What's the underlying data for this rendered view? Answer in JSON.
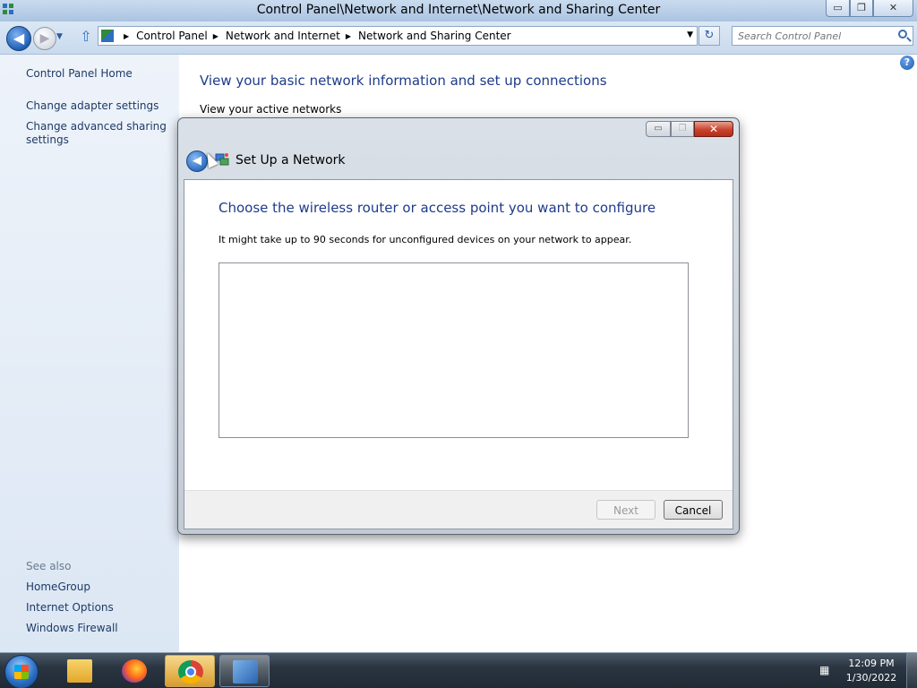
{
  "window": {
    "title": "Control Panel\\Network and Internet\\Network and Sharing Center",
    "buttons": {
      "minimize": "▭",
      "maximize": "❐",
      "close": "✕"
    }
  },
  "navigation": {
    "breadcrumbs": [
      "Control Panel",
      "Network and Internet",
      "Network and Sharing Center"
    ],
    "search_placeholder": "Search Control Panel"
  },
  "sidebar": {
    "links": [
      "Control Panel Home",
      "Change adapter settings",
      "Change advanced sharing settings"
    ],
    "see_also_label": "See also",
    "see_also": [
      "HomeGroup",
      "Internet Options",
      "Windows Firewall"
    ]
  },
  "main": {
    "heading": "View your basic network information and set up connections",
    "subheading": "View your active networks"
  },
  "dialog": {
    "title": "Set Up a Network",
    "heading": "Choose the wireless router or access point you want to configure",
    "description": "It might take up to 90 seconds for unconfigured devices on your network to appear.",
    "next_label": "Next",
    "cancel_label": "Cancel",
    "close_glyph": "✕"
  },
  "taskbar": {
    "apps": [
      "explorer",
      "firefox",
      "chrome",
      "control-panel"
    ],
    "active_app": "chrome",
    "time": "12:09 PM",
    "date": "1/30/2022"
  },
  "colors": {
    "link": "#1e3966",
    "heading": "#1e3b8a",
    "dialog_close": "#c8432e",
    "taskbar_active": "#d99c2c"
  },
  "icons": {
    "system": "network-icon",
    "back": "back-arrow-icon",
    "forward": "forward-arrow-icon",
    "up": "up-arrow-icon",
    "search": "search-icon",
    "help": "help-icon",
    "refresh": "refresh-icon"
  }
}
